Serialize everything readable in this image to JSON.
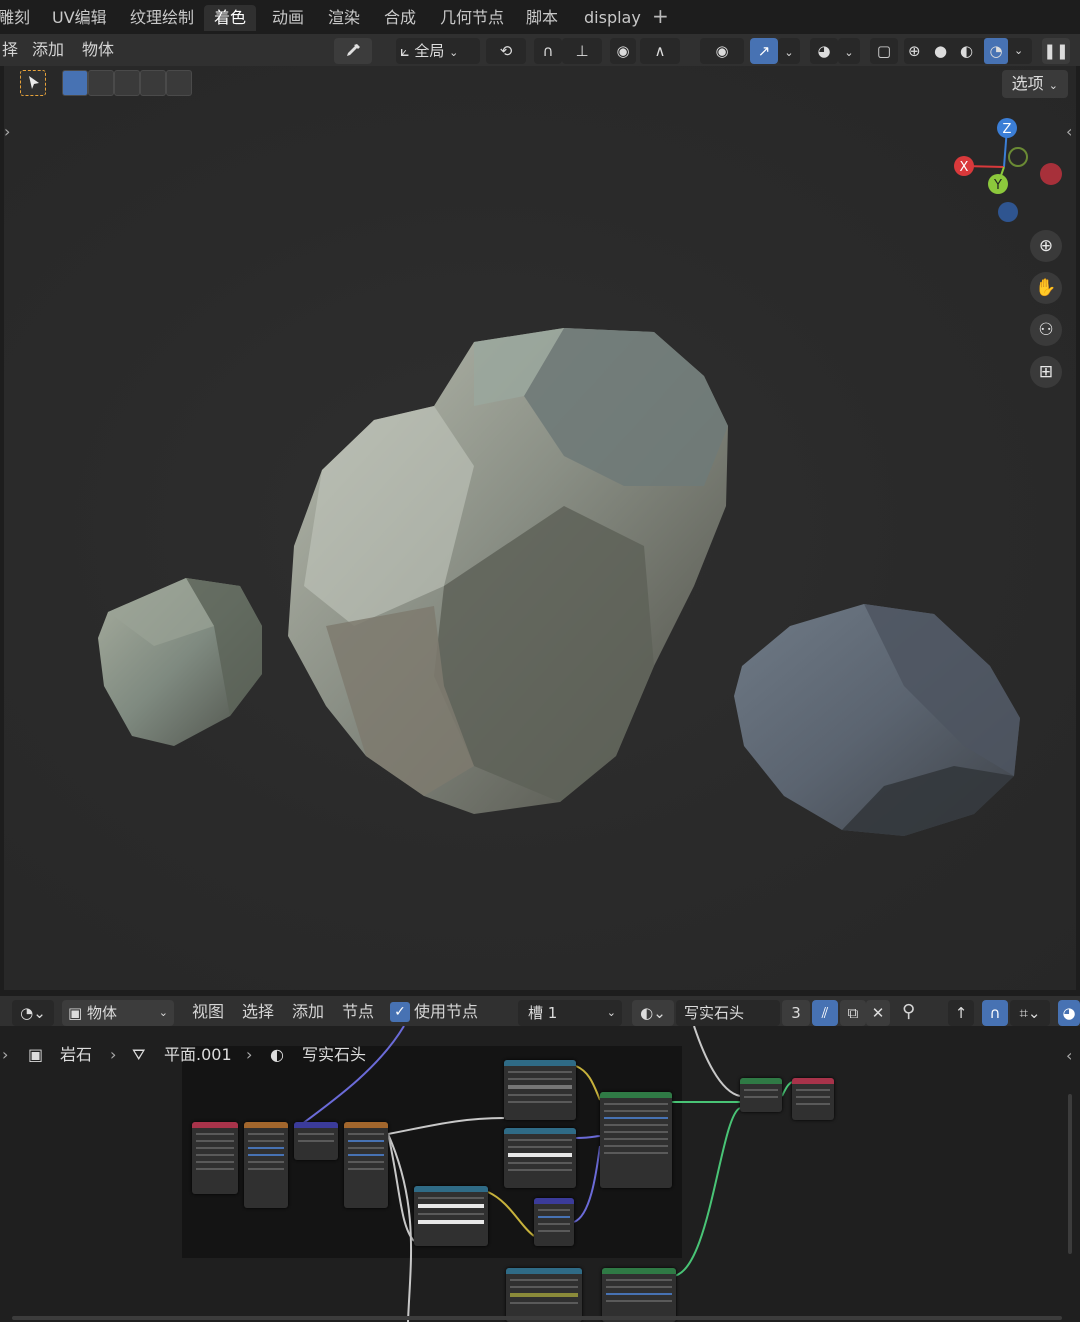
{
  "workspace_tabs": [
    "雕刻",
    "UV编辑",
    "纹理绘制",
    "着色",
    "动画",
    "渲染",
    "合成",
    "几何节点",
    "脚本",
    "display"
  ],
  "active_tab": "着色",
  "tab_add": "+",
  "viewport_header": {
    "menus": [
      "择",
      "添加",
      "物体"
    ],
    "transform_orientation": "全局",
    "options": "选项"
  },
  "gizmo": {
    "z": "Z",
    "x": "X",
    "y": "Y"
  },
  "node_editor_header": {
    "menu_object": "物体",
    "menus": [
      "视图",
      "选择",
      "添加",
      "节点"
    ],
    "use_nodes_label": "使用节点",
    "use_nodes_checked": true,
    "slot": "槽 1",
    "material_name": "写实石头",
    "user_count": "3"
  },
  "breadcrumb": {
    "object": "岩石",
    "mesh": "平面.001",
    "material": "写实石头"
  },
  "colors": {
    "accent_blue": "#4772b3",
    "gizmo_x": "#d9393b",
    "gizmo_y": "#8cc83c",
    "gizmo_z": "#3b7ed6",
    "header_bg": "#303030",
    "viewport_bg": "#2b2b2b"
  }
}
